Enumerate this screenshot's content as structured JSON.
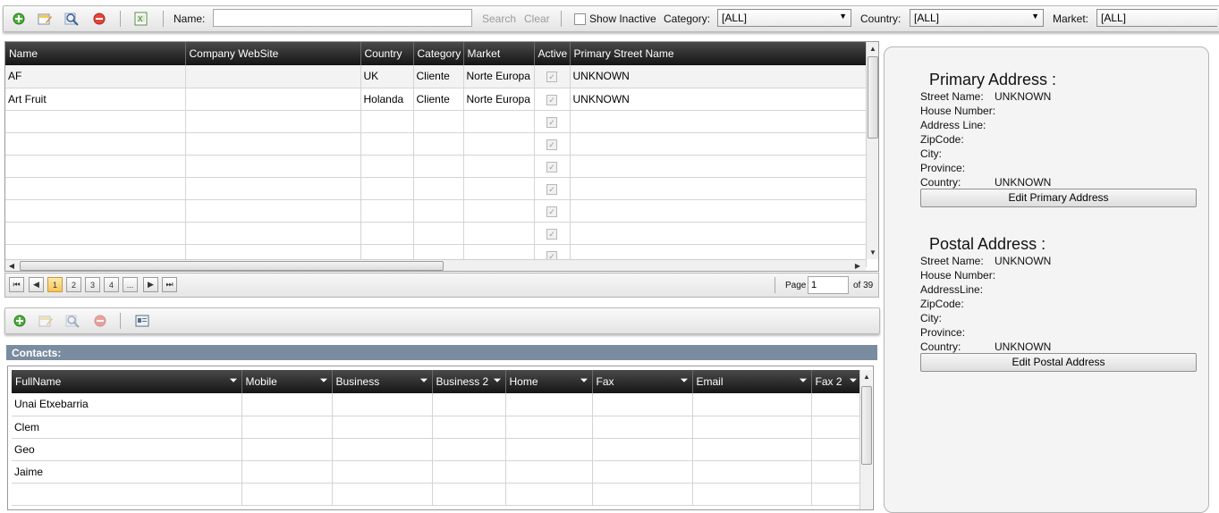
{
  "toolbar": {
    "name_label": "Name:",
    "name_value": "",
    "search_label": "Search",
    "clear_label": "Clear",
    "show_inactive_label": "Show Inactive",
    "category_label": "Category:",
    "category_value": "[ALL]",
    "country_label": "Country:",
    "country_value": "[ALL]",
    "market_label": "Market:",
    "market_value": "[ALL]"
  },
  "customers": {
    "columns": [
      "Name",
      "Company WebSite",
      "Country",
      "Category",
      "Market",
      "Active",
      "Primary Street Name"
    ],
    "rows": [
      [
        "AF",
        "",
        "UK",
        "Cliente",
        "Norte Europa",
        "checked",
        "UNKNOWN"
      ],
      [
        "Art Fruit",
        "",
        "Holanda",
        "Cliente",
        "Norte Europa",
        "checked",
        "UNKNOWN"
      ]
    ],
    "empty_rows": 7
  },
  "pager": {
    "pages": [
      "1",
      "2",
      "3",
      "4",
      "..."
    ],
    "current": "1",
    "page_label": "Page",
    "page_value": "1",
    "of_label": "of 39"
  },
  "contacts": {
    "section_label": "Contacts:",
    "columns": [
      "FullName",
      "Mobile",
      "Business",
      "Business 2",
      "Home",
      "Fax",
      "Email",
      "Fax 2"
    ],
    "rows": [
      "Unai Etxebarria",
      "Clem",
      "Geo",
      "Jaime",
      ""
    ]
  },
  "primary_address": {
    "title": "Primary Address :",
    "street_label": "Street Name:",
    "street_value": "UNKNOWN",
    "house_label": "House Number:",
    "address_line_label": "Address Line:",
    "zip_label": "ZipCode:",
    "city_label": "City:",
    "province_label": "Province:",
    "country_label": "Country:",
    "country_value": "UNKNOWN",
    "edit_label": "Edit Primary Address"
  },
  "postal_address": {
    "title": "Postal Address :",
    "street_label": "Street Name:",
    "street_value": "UNKNOWN",
    "house_label": "House Number:",
    "address_line_label": "AddressLine:",
    "zip_label": "ZipCode:",
    "city_label": "City:",
    "province_label": "Province:",
    "country_label": "Country:",
    "country_value": "UNKNOWN",
    "edit_label": "Edit Postal Address"
  },
  "icons": {
    "add": "add-icon",
    "edit": "edit-icon",
    "view": "magnifier-icon",
    "delete": "delete-icon",
    "export": "excel-export-icon",
    "contact_card": "contact-card-icon"
  },
  "colors": {
    "header_dark": "#1a1a1a",
    "section_bar": "#7a8ca0",
    "active_page": "#f7c45b"
  }
}
